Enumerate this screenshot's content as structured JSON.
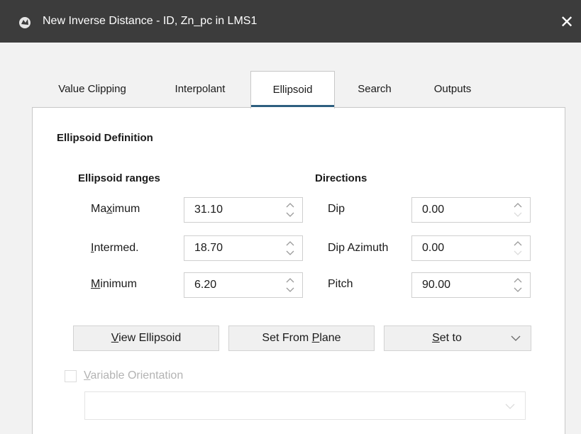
{
  "window": {
    "title": "New Inverse Distance - ID, Zn_pc in LMS1",
    "close_glyph": "✕",
    "app_icon": "leapfrog-app-icon"
  },
  "tabs": [
    {
      "label": "Value Clipping",
      "active": false
    },
    {
      "label": "Interpolant",
      "active": false
    },
    {
      "label": "Ellipsoid",
      "active": true
    },
    {
      "label": "Search",
      "active": false
    },
    {
      "label": "Outputs",
      "active": false
    }
  ],
  "ellipsoid": {
    "section_title": "Ellipsoid Definition",
    "ranges": {
      "heading": "Ellipsoid ranges",
      "maximum": {
        "pre": "Ma",
        "key": "x",
        "post": "imum",
        "value": "31.10"
      },
      "intermed": {
        "pre": "",
        "key": "I",
        "post": "ntermed.",
        "value": "18.70"
      },
      "minimum": {
        "pre": "",
        "key": "M",
        "post": "inimum",
        "value": "6.20"
      }
    },
    "directions": {
      "heading": "Directions",
      "dip": {
        "label": "Dip",
        "value": "0.00"
      },
      "dip_azimuth": {
        "label": "Dip Azimuth",
        "value": "0.00"
      },
      "pitch": {
        "label": "Pitch",
        "value": "90.00"
      }
    },
    "buttons": {
      "view": {
        "key": "V",
        "rest": "iew Ellipsoid"
      },
      "set_from_plane": {
        "pre": "Set From ",
        "key": "P",
        "post": "lane"
      },
      "set_to": {
        "key": "S",
        "rest": "et to"
      }
    },
    "variable_orientation": {
      "key": "V",
      "rest": "ariable Orientation",
      "checked": false,
      "enabled": false
    }
  },
  "colors": {
    "titlebar": "#3c3c3c",
    "active_tab_underline": "#2d5f7f",
    "disabled_text": "#b3b3b3"
  }
}
